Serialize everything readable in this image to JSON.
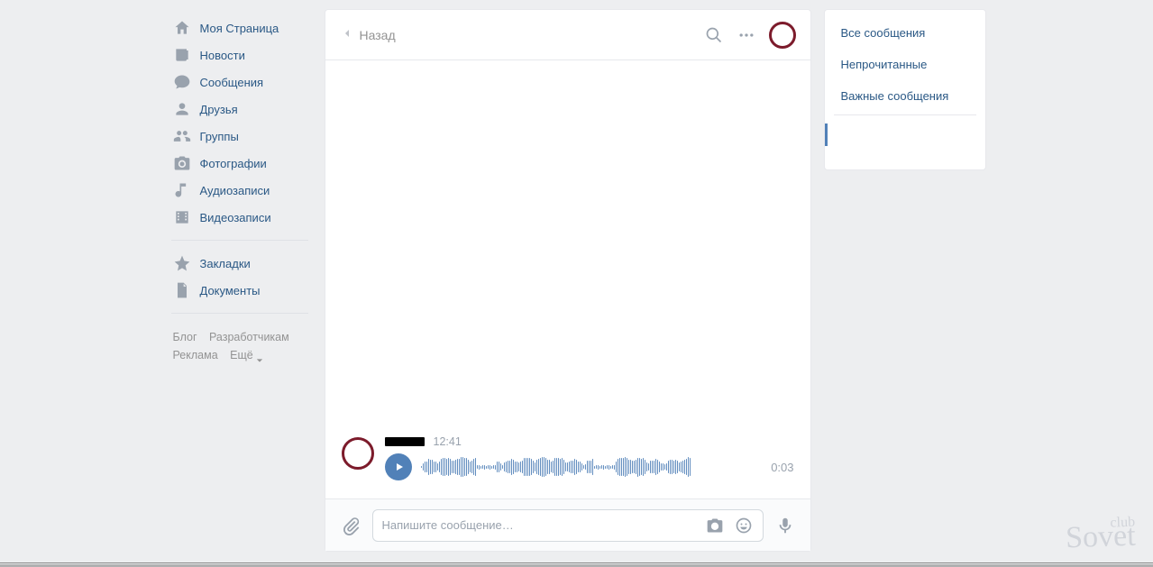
{
  "sidebar": {
    "items": [
      {
        "label": "Моя Страница",
        "name": "my-page"
      },
      {
        "label": "Новости",
        "name": "news"
      },
      {
        "label": "Сообщения",
        "name": "messages"
      },
      {
        "label": "Друзья",
        "name": "friends"
      },
      {
        "label": "Группы",
        "name": "groups"
      },
      {
        "label": "Фотографии",
        "name": "photos"
      },
      {
        "label": "Аудиозаписи",
        "name": "audio"
      },
      {
        "label": "Видеозаписи",
        "name": "video"
      }
    ],
    "more_items": [
      {
        "label": "Закладки",
        "name": "bookmarks"
      },
      {
        "label": "Документы",
        "name": "documents"
      }
    ]
  },
  "footer": {
    "blog": "Блог",
    "devs": "Разработчикам",
    "ads": "Реклама",
    "more": "Ещё"
  },
  "chat": {
    "back": "Назад",
    "title_placeholder": "",
    "message": {
      "time": "12:41",
      "voice_duration": "0:03"
    },
    "compose_placeholder": "Напишите сообщение…"
  },
  "filters": {
    "all": "Все сообщения",
    "unread": "Непрочитанные",
    "important": "Важные сообщения"
  },
  "watermark": {
    "top": "club",
    "bottom": "Sovet"
  }
}
